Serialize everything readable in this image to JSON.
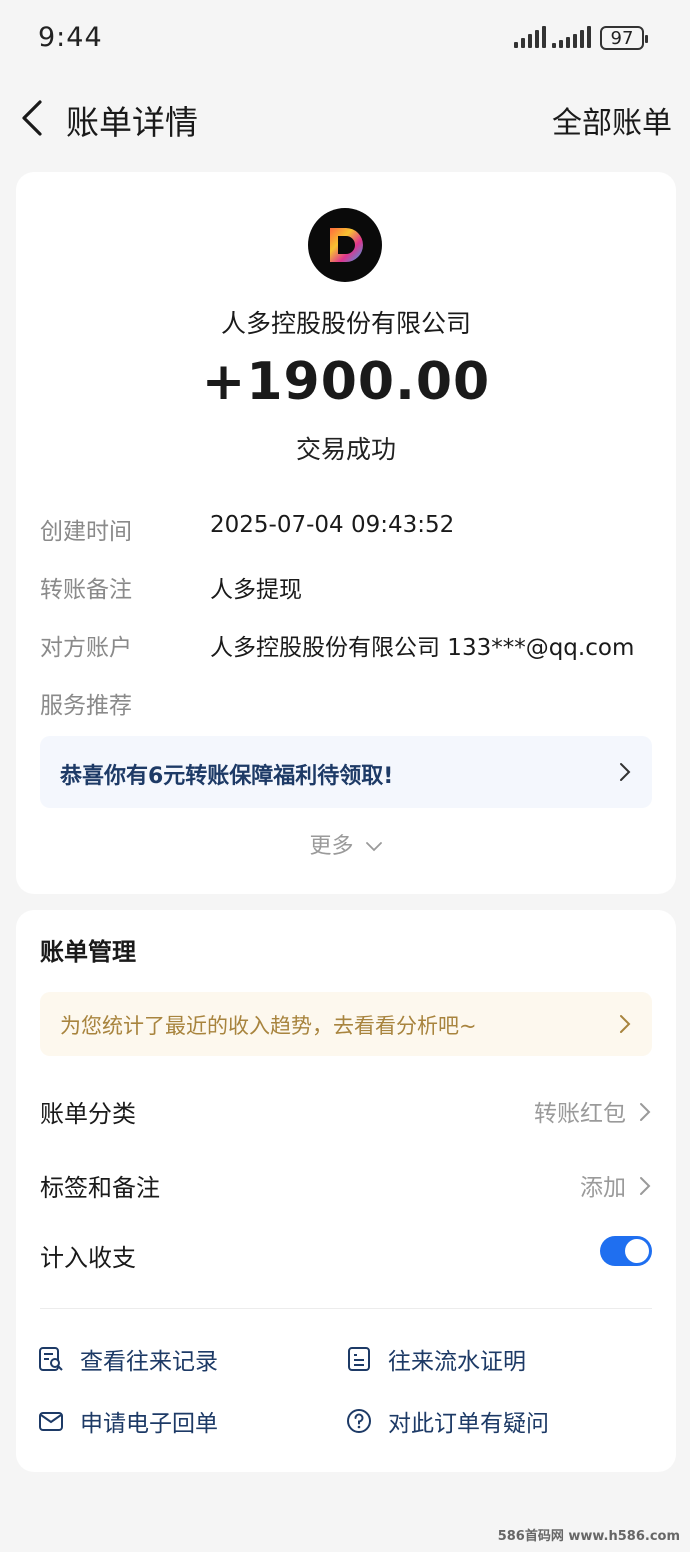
{
  "status_bar": {
    "time": "9:44",
    "battery": "97"
  },
  "nav": {
    "title": "账单详情",
    "right_action": "全部账单"
  },
  "transaction": {
    "merchant": "人多控股股份有限公司",
    "amount": "+1900.00",
    "status": "交易成功"
  },
  "details": [
    {
      "label": "创建时间",
      "value": "2025-07-04 09:43:52"
    },
    {
      "label": "转账备注",
      "value": "人多提现"
    },
    {
      "label": "对方账户",
      "value": "人多控股股份有限公司 133***@qq.com"
    },
    {
      "label": "服务推荐",
      "value": ""
    }
  ],
  "promo": {
    "text": "恭喜你有6元转账保障福利待领取!"
  },
  "more": {
    "label": "更多"
  },
  "management": {
    "title": "账单管理",
    "insight": "为您统计了最近的收入趋势，去看看分析吧~",
    "category": {
      "label": "账单分类",
      "value": "转账红包"
    },
    "tags": {
      "label": "标签和备注",
      "value": "添加"
    },
    "include": {
      "label": "计入收支",
      "enabled": true
    }
  },
  "links": {
    "records": "查看往来记录",
    "statement": "往来流水证明",
    "receipt": "申请电子回单",
    "question": "对此订单有疑问"
  },
  "watermark": "586首码网 www.h586.com",
  "colors": {
    "accent": "#1f6ff0",
    "link": "#1d3a66",
    "insight_text": "#a8843e"
  }
}
